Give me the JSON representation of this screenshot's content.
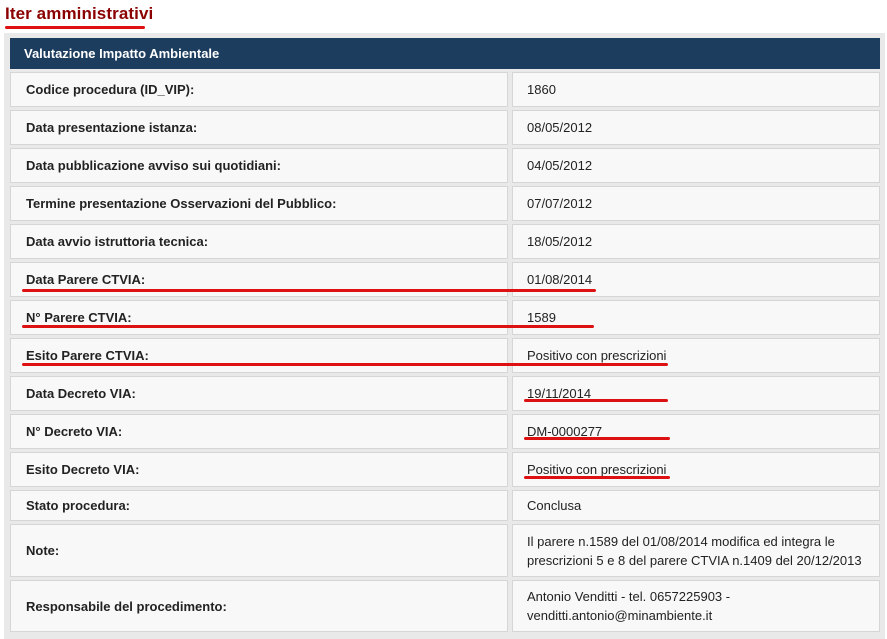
{
  "page": {
    "title": "Iter amministrativi",
    "section_title": "Valutazione Impatto Ambientale",
    "accent_color": "#dd1111",
    "header_color": "#1c3d5e"
  },
  "rows": [
    {
      "label": "Codice procedura (ID_VIP):",
      "value": "1860"
    },
    {
      "label": "Data presentazione istanza:",
      "value": "08/05/2012"
    },
    {
      "label": "Data pubblicazione avviso sui quotidiani:",
      "value": "04/05/2012"
    },
    {
      "label": "Termine presentazione Osservazioni del Pubblico:",
      "value": "07/07/2012"
    },
    {
      "label": "Data avvio istruttoria tecnica:",
      "value": "18/05/2012"
    },
    {
      "label": "Data Parere CTVIA:",
      "value": "01/08/2014"
    },
    {
      "label": "N° Parere CTVIA:",
      "value": "1589"
    },
    {
      "label": "Esito Parere CTVIA:",
      "value": "Positivo con prescrizioni"
    },
    {
      "label": "Data Decreto VIA:",
      "value": "19/11/2014"
    },
    {
      "label": "N° Decreto VIA:",
      "value": "DM-0000277"
    },
    {
      "label": "Esito Decreto VIA:",
      "value": "Positivo con prescrizioni"
    },
    {
      "label": "Stato procedura:",
      "value": "Conclusa"
    },
    {
      "label": "Note:",
      "value": "Il parere n.1589 del 01/08/2014 modifica ed integra le prescrizioni 5 e 8 del parere CTVIA n.1409 del 20/12/2013"
    },
    {
      "label": "Responsabile del procedimento:",
      "value": "Antonio Venditti - tel. 0657225903 - venditti.antonio@minambiente.it"
    }
  ]
}
